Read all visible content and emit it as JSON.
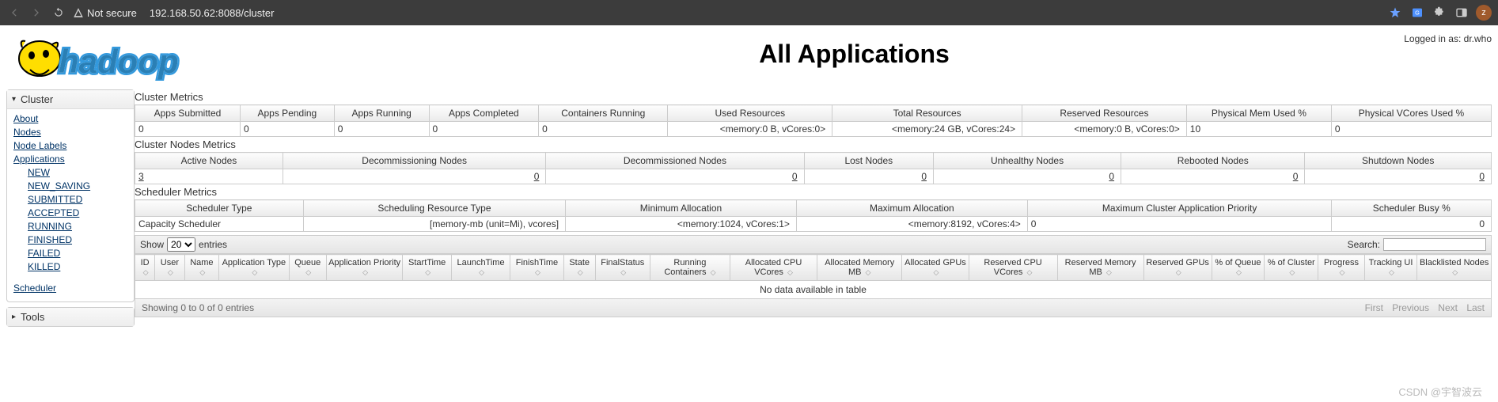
{
  "browser": {
    "not_secure_label": "Not secure",
    "url": "192.168.50.62:8088/cluster",
    "avatar_letter": "z"
  },
  "header": {
    "login_text": "Logged in as: dr.who",
    "page_title": "All Applications"
  },
  "sidebar": {
    "cluster": {
      "title": "Cluster",
      "links": [
        "About",
        "Nodes",
        "Node Labels",
        "Applications"
      ],
      "app_states": [
        "NEW",
        "NEW_SAVING",
        "SUBMITTED",
        "ACCEPTED",
        "RUNNING",
        "FINISHED",
        "FAILED",
        "KILLED"
      ],
      "scheduler": "Scheduler"
    },
    "tools": {
      "title": "Tools"
    }
  },
  "cluster_metrics": {
    "title": "Cluster Metrics",
    "headers": [
      "Apps Submitted",
      "Apps Pending",
      "Apps Running",
      "Apps Completed",
      "Containers Running",
      "Used Resources",
      "Total Resources",
      "Reserved Resources",
      "Physical Mem Used %",
      "Physical VCores Used %"
    ],
    "values": [
      "0",
      "0",
      "0",
      "0",
      "0",
      "<memory:0 B, vCores:0>",
      "<memory:24 GB, vCores:24>",
      "<memory:0 B, vCores:0>",
      "10",
      "0"
    ]
  },
  "nodes_metrics": {
    "title": "Cluster Nodes Metrics",
    "headers": [
      "Active Nodes",
      "Decommissioning Nodes",
      "Decommissioned Nodes",
      "Lost Nodes",
      "Unhealthy Nodes",
      "Rebooted Nodes",
      "Shutdown Nodes"
    ],
    "values": [
      "3",
      "0",
      "0",
      "0",
      "0",
      "0",
      "0"
    ]
  },
  "scheduler_metrics": {
    "title": "Scheduler Metrics",
    "headers": [
      "Scheduler Type",
      "Scheduling Resource Type",
      "Minimum Allocation",
      "Maximum Allocation",
      "Maximum Cluster Application Priority",
      "Scheduler Busy %"
    ],
    "values": [
      "Capacity Scheduler",
      "[memory-mb (unit=Mi), vcores]",
      "<memory:1024, vCores:1>",
      "<memory:8192, vCores:4>",
      "0",
      "0"
    ]
  },
  "datatable": {
    "show_label": "Show",
    "entries_label": "entries",
    "page_size": "20",
    "search_label": "Search:",
    "headers": [
      "ID",
      "User",
      "Name",
      "Application Type",
      "Queue",
      "Application Priority",
      "StartTime",
      "LaunchTime",
      "FinishTime",
      "State",
      "FinalStatus",
      "Running Containers",
      "Allocated CPU VCores",
      "Allocated Memory MB",
      "Allocated GPUs",
      "Reserved CPU VCores",
      "Reserved Memory MB",
      "Reserved GPUs",
      "% of Queue",
      "% of Cluster",
      "Progress",
      "Tracking UI",
      "Blacklisted Nodes"
    ],
    "empty_text": "No data available in table",
    "info_text": "Showing 0 to 0 of 0 entries",
    "pager": [
      "First",
      "Previous",
      "Next",
      "Last"
    ]
  },
  "watermark": "CSDN @宇智波云"
}
